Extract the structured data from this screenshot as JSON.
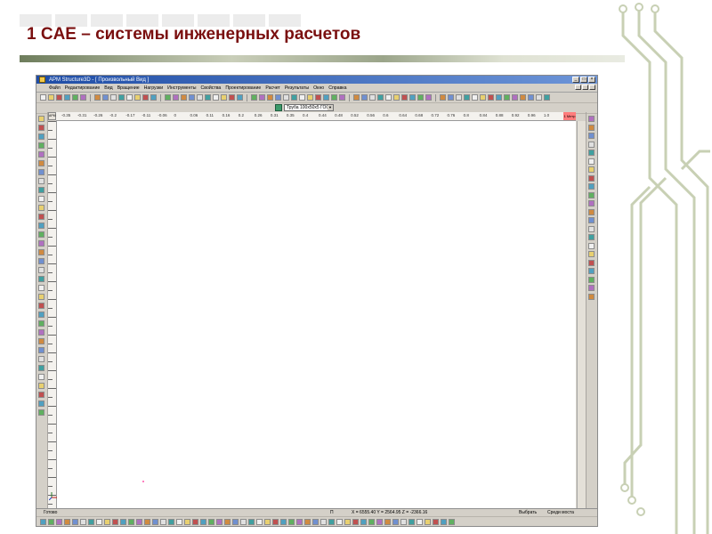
{
  "slide": {
    "title": "1 CAE – системы инженерных расчетов"
  },
  "app": {
    "window_title": "APM Structure3D - [ Произвольный Вид ]",
    "menu": [
      "Файл",
      "Редактирование",
      "Вид",
      "Вращение",
      "Нагрузки",
      "Инструменты",
      "Свойства",
      "Проектирование",
      "Расчет",
      "Результаты",
      "Окно",
      "Справка"
    ],
    "section_combo": {
      "value": "Труба 100x50x5 ГОСТ",
      "icon": "section-icon"
    },
    "ruler_corner": "APM",
    "ruler_ticks": [
      "-0.35",
      "-0.31",
      "-0.26",
      "-0.2",
      "-0.17",
      "-0.11",
      "-0.06",
      "0",
      "0.06",
      "0.11",
      "0.16",
      "0.2",
      "0.26",
      "0.31",
      "0.35",
      "0.4",
      "0.44",
      "0.48",
      "0.52",
      "0.56",
      "0.6",
      "0.64",
      "0.68",
      "0.72",
      "0.76",
      "0.8",
      "0.84",
      "0.88",
      "0.92",
      "0.96",
      "1.0"
    ],
    "ruler_unit": "1 Метр",
    "status": {
      "state": "Готово",
      "field": "П",
      "coordinates": "X = 6555.40 Y = 2564.95 Z = -2366.16",
      "select": "Выбрать",
      "mode": "Среди моста"
    }
  },
  "colors": {
    "title_red": "#7a0f0f",
    "titlebar_blue": "#1f4da6",
    "circuit_green": "#c8d0b4",
    "window_gray": "#d4d0c8"
  }
}
